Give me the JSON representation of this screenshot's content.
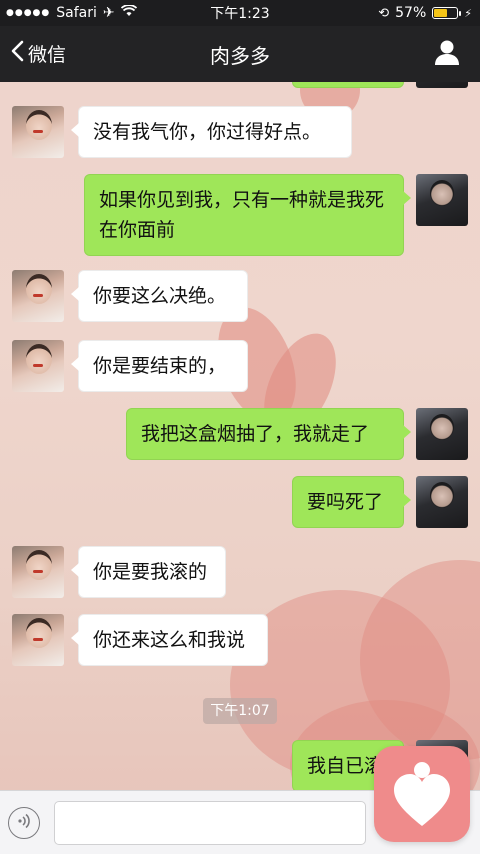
{
  "status_bar": {
    "carrier": "Safari",
    "time": "下午1:23",
    "battery": "57%",
    "battery_level": 0.57
  },
  "nav": {
    "back_label": "微信",
    "title": "肉多多",
    "profile_icon": "person-icon"
  },
  "messages": [
    {
      "side": "in",
      "text": "没有我气你，你过得好点。"
    },
    {
      "side": "out",
      "text": "如果你见到我，只有一种就是我死在你面前"
    },
    {
      "side": "in",
      "text": "你要这么决绝。"
    },
    {
      "side": "in",
      "text": "你是要结束的，"
    },
    {
      "side": "out",
      "text": "我把这盒烟抽了，我就走了"
    },
    {
      "side": "out",
      "text": "要吗死了"
    },
    {
      "side": "in",
      "text": "你是要我滚的"
    },
    {
      "side": "in",
      "text": "你还来这么和我说"
    },
    {
      "side": "out",
      "text": "我自已滚"
    }
  ],
  "timestamp": "下午1:07",
  "colors": {
    "outgoing_bubble": "#9fe659",
    "incoming_bubble": "#ffffff",
    "nav_bg": "#232325",
    "overlay_app": "#ef8b8b"
  }
}
